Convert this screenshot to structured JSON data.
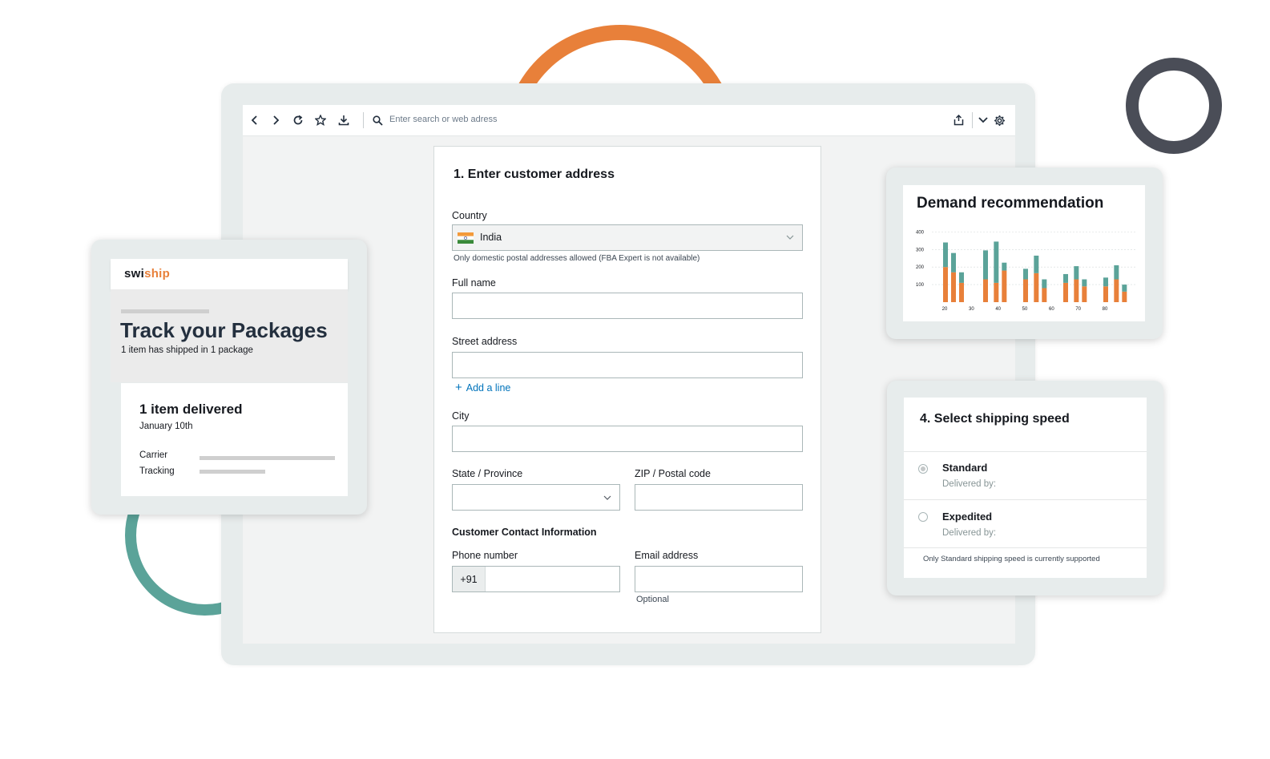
{
  "browser": {
    "url_placeholder": "Enter search or web adress"
  },
  "address_form": {
    "title": "1. Enter customer address",
    "country_label": "Country",
    "country_value": "India",
    "country_hint": "Only domestic postal addresses allowed (FBA Expert is not available)",
    "full_name_label": "Full name",
    "street_label": "Street address",
    "add_line": "Add a line",
    "city_label": "City",
    "state_label": "State / Province",
    "zip_label": "ZIP / Postal code",
    "contact_section": "Customer Contact Information",
    "phone_label": "Phone number",
    "phone_prefix": "+91",
    "email_label": "Email address",
    "email_hint": "Optional"
  },
  "tracking": {
    "logo_part1": "swi",
    "logo_part2": "ship",
    "title": "Track your Packages",
    "subtitle": "1 item has shipped in 1 package",
    "status": "1 item delivered",
    "date": "January 10th",
    "carrier_label": "Carrier",
    "tracking_label": "Tracking"
  },
  "demand": {
    "title": "Demand recommendation"
  },
  "chart_data": {
    "type": "bar",
    "stacked": true,
    "yticks": [
      "400",
      "300",
      "200",
      "100"
    ],
    "xticks": [
      "20",
      "30",
      "40",
      "50",
      "60",
      "70",
      "80"
    ],
    "ylim": [
      0,
      420
    ],
    "colors": {
      "bottom": "#e8803a",
      "top": "#5ba399"
    },
    "bars": [
      {
        "x": 20,
        "bottom": 200,
        "top": 140
      },
      {
        "x": 23,
        "bottom": 170,
        "top": 110
      },
      {
        "x": 26,
        "bottom": 110,
        "top": 60
      },
      {
        "x": 35,
        "bottom": 130,
        "top": 165
      },
      {
        "x": 39,
        "bottom": 110,
        "top": 235
      },
      {
        "x": 42,
        "bottom": 180,
        "top": 45
      },
      {
        "x": 50,
        "bottom": 130,
        "top": 60
      },
      {
        "x": 54,
        "bottom": 165,
        "top": 100
      },
      {
        "x": 57,
        "bottom": 80,
        "top": 50
      },
      {
        "x": 65,
        "bottom": 110,
        "top": 50
      },
      {
        "x": 69,
        "bottom": 130,
        "top": 75
      },
      {
        "x": 72,
        "bottom": 90,
        "top": 40
      },
      {
        "x": 80,
        "bottom": 90,
        "top": 50
      },
      {
        "x": 84,
        "bottom": 130,
        "top": 80
      },
      {
        "x": 87,
        "bottom": 60,
        "top": 40
      }
    ]
  },
  "shipping": {
    "title": "4. Select shipping speed",
    "options": [
      {
        "label": "Standard",
        "sub": "Delivered by:"
      },
      {
        "label": "Expedited",
        "sub": "Delivered by:"
      }
    ],
    "note": "Only Standard shipping speed is currently supported"
  },
  "colors": {
    "orange": "#e8803a",
    "teal": "#5ba399",
    "dark_ring": "#4a4d57",
    "link": "#0073bb"
  },
  "icons": [
    "back-icon",
    "forward-icon",
    "reload-icon",
    "star-icon",
    "download-icon",
    "search-icon",
    "share-icon",
    "chevron-down-icon",
    "gear-icon",
    "india-flag-icon",
    "plus-icon"
  ]
}
